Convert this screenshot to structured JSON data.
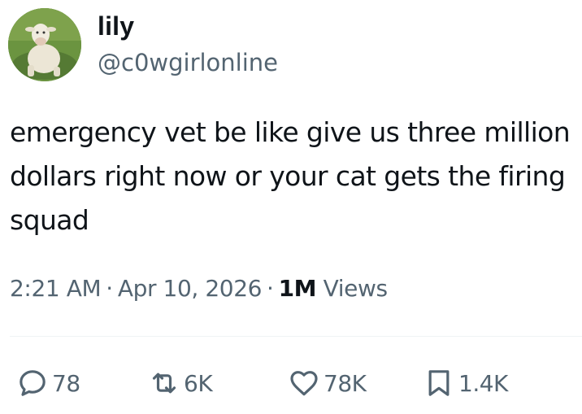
{
  "author": {
    "display_name": "lily",
    "handle": "@c0wgirlonline",
    "avatar_description_icon": "cow-avatar"
  },
  "tweet": {
    "text": "emergency vet be like give us three million dollars right now or your cat gets the firing squad"
  },
  "meta": {
    "time": "2:21 AM",
    "separator": "·",
    "date": "Apr 10, 2026",
    "views_count": "1M",
    "views_label": "Views"
  },
  "actions": {
    "reply_count": "78",
    "retweet_count": "6K",
    "like_count": "78K",
    "bookmark_count": "1.4K"
  },
  "colors": {
    "text_primary": "#0f1419",
    "text_secondary": "#536471",
    "divider": "#eff3f4",
    "background": "#ffffff"
  }
}
